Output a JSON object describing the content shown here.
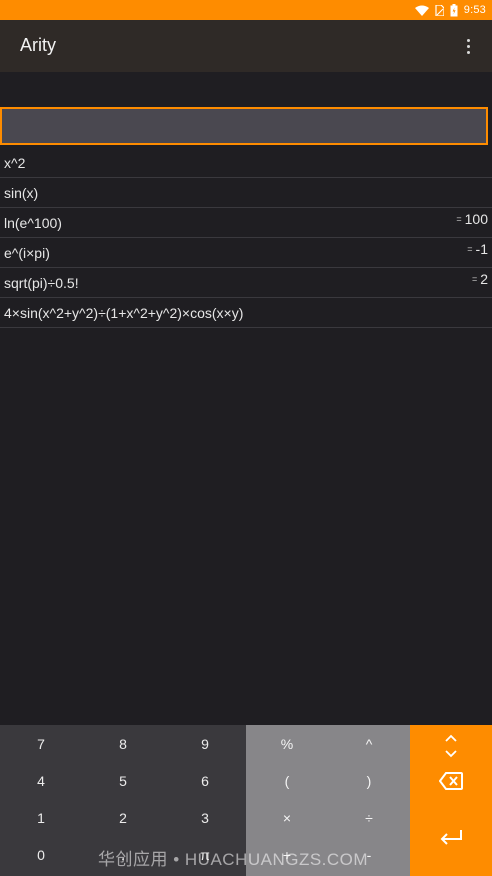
{
  "status_bar": {
    "time": "9:53",
    "icons": [
      "wifi-icon",
      "sim-icon",
      "battery-icon"
    ],
    "bg_color": "#fe8c00"
  },
  "app_bar": {
    "title": "Arity",
    "menu_icon": "overflow-menu-icon"
  },
  "input": {
    "value": "",
    "placeholder": "",
    "accent_color": "#fe8c00"
  },
  "history": [
    {
      "expression": "x^2",
      "eq": "",
      "result": ""
    },
    {
      "expression": "sin(x)",
      "eq": "",
      "result": ""
    },
    {
      "expression": "ln(e^100)",
      "eq": "=",
      "result": "100"
    },
    {
      "expression": "e^(i×pi)",
      "eq": "=",
      "result": "-1"
    },
    {
      "expression": "sqrt(pi)÷0.5!",
      "eq": "=",
      "result": "2"
    },
    {
      "expression": "4×sin(x^2+y^2)÷(1+x^2+y^2)×cos(x×y)",
      "eq": "",
      "result": ""
    }
  ],
  "keypad": {
    "numbers": [
      [
        "7",
        "8",
        "9"
      ],
      [
        "4",
        "5",
        "6"
      ],
      [
        "1",
        "2",
        "3"
      ],
      [
        "0",
        ".",
        ""
      ]
    ],
    "operators": [
      [
        "%",
        "^"
      ],
      [
        "(",
        ")"
      ],
      [
        "×",
        "÷"
      ],
      [
        "+",
        "-"
      ]
    ],
    "actions": [
      "expand-collapse-icon",
      "backspace-icon",
      "enter-icon"
    ],
    "colors": {
      "numbers_bg": "#3a393d",
      "operators_bg": "#878689",
      "actions_bg": "#fe8c00"
    }
  },
  "watermark": "华创应用 • HUACHUANGZS.COM"
}
